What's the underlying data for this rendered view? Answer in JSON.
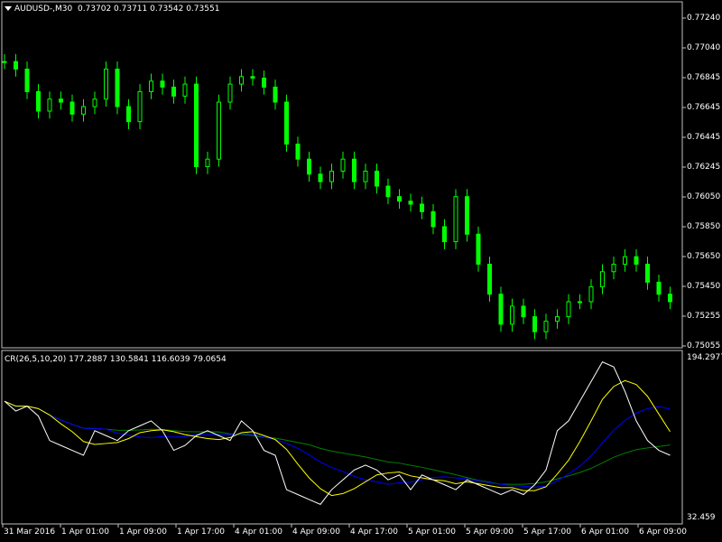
{
  "main_panel": {
    "symbol": "AUDUSD-,M30",
    "ohlc": "0.73702 0.73711 0.73542 0.73551",
    "price_labels": [
      "0.77240",
      "0.77040",
      "0.76845",
      "0.76645",
      "0.76445",
      "0.76245",
      "0.76050",
      "0.75850",
      "0.75650",
      "0.75450",
      "0.75255",
      "0.75055"
    ]
  },
  "indicator_panel": {
    "title": "CR(26,5,10,20) 177.2887 130.5841 116.6039 79.0654",
    "max_label": "194.2977",
    "min_label": "32.459"
  },
  "time_labels": [
    "31 Mar 2016",
    "1 Apr 01:00",
    "1 Apr 09:00",
    "1 Apr 17:00",
    "4 Apr 01:00",
    "4 Apr 09:00",
    "4 Apr 17:00",
    "5 Apr 01:00",
    "5 Apr 09:00",
    "5 Apr 17:00",
    "6 Apr 01:00",
    "6 Apr 09:00"
  ],
  "colors": {
    "background": "#000000",
    "border": "#c0c0c0",
    "candle": "#00ff00",
    "cr_line": "#ffffff",
    "ma1": "#ffff00",
    "ma2": "#0000ff",
    "ma3": "#008000"
  },
  "chart_data": {
    "type": "line",
    "series": [
      {
        "name": "AUDUSD-,M30",
        "values": [
          0.7695,
          0.769,
          0.7675,
          0.7662,
          0.767,
          0.7668,
          0.766,
          0.7665,
          0.767,
          0.769,
          0.7665,
          0.7655,
          0.7675,
          0.7682,
          0.7678,
          0.7672,
          0.768,
          0.7625,
          0.763,
          0.7668,
          0.768,
          0.7685,
          0.7684,
          0.7678,
          0.7668,
          0.764,
          0.763,
          0.762,
          0.7615,
          0.7622,
          0.763,
          0.7615,
          0.7622,
          0.7612,
          0.7605,
          0.7602,
          0.76,
          0.7595,
          0.7585,
          0.7575,
          0.7605,
          0.758,
          0.756,
          0.754,
          0.752,
          0.7532,
          0.7525,
          0.7515,
          0.7522,
          0.7525,
          0.7535,
          0.7535,
          0.7545,
          0.7555,
          0.756,
          0.7565,
          0.756,
          0.7548,
          0.754,
          0.7535
        ]
      },
      {
        "name": "CR",
        "values": [
          150,
          140,
          145,
          135,
          110,
          105,
          100,
          95,
          120,
          115,
          110,
          120,
          125,
          130,
          120,
          100,
          105,
          115,
          120,
          115,
          110,
          130,
          120,
          100,
          95,
          60,
          55,
          50,
          45,
          60,
          70,
          80,
          85,
          80,
          70,
          75,
          60,
          75,
          70,
          65,
          60,
          70,
          65,
          60,
          55,
          60,
          55,
          65,
          80,
          120,
          130,
          150,
          170,
          190,
          185,
          160,
          130,
          110,
          100,
          95
        ]
      }
    ],
    "ylim": [
      0.75055,
      0.7724
    ],
    "indicator_ylim": [
      32.459,
      194.2977
    ]
  }
}
